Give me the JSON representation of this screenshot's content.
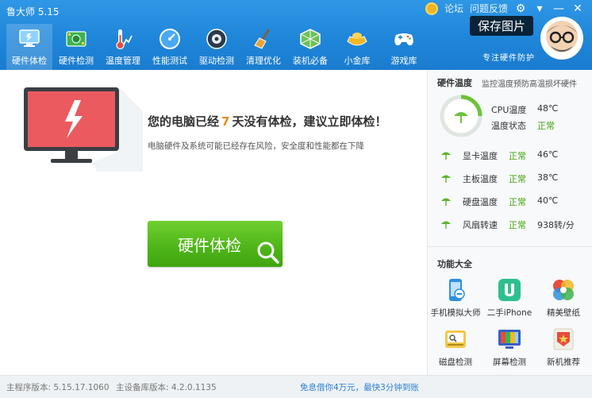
{
  "app": {
    "title": "鲁大师 5.15"
  },
  "window_controls": {
    "forum": "论坛",
    "feedback": "问题反馈",
    "settings": "⚙",
    "menu": "▾",
    "minimize": "—",
    "close": "✕"
  },
  "nav": {
    "tabs": [
      {
        "label": "硬件体检",
        "icon": "monitor-icon",
        "active": true
      },
      {
        "label": "硬件检测",
        "icon": "chip-icon"
      },
      {
        "label": "温度管理",
        "icon": "thermometer-icon"
      },
      {
        "label": "性能测试",
        "icon": "speedometer-icon"
      },
      {
        "label": "驱动检测",
        "icon": "driver-icon"
      },
      {
        "label": "清理优化",
        "icon": "broom-icon"
      },
      {
        "label": "装机必备",
        "icon": "cube-icon"
      },
      {
        "label": "小金库",
        "icon": "gold-ingot-icon"
      },
      {
        "label": "游戏库",
        "icon": "gamepad-icon"
      }
    ]
  },
  "brand": {
    "save_image": "保存图片",
    "name": "鲁大师",
    "slogan": "专注硬件防护"
  },
  "main": {
    "headline_pre": "您的电脑已经",
    "days": "7",
    "headline_post": "天没有体检，建议立即体检！",
    "subtext": "电脑硬件及系统可能已经存在风险，安全度和性能都在下降",
    "check_button": "硬件体检"
  },
  "temps": {
    "header": "硬件温度",
    "header_desc": "监控温度预防高温损坏硬件",
    "cpu_label": "CPU温度",
    "cpu_value": "48℃",
    "state_label": "温度状态",
    "state_value": "正常",
    "sensors": [
      {
        "label": "显卡温度",
        "status": "正常",
        "value": "46℃"
      },
      {
        "label": "主板温度",
        "status": "正常",
        "value": "38℃"
      },
      {
        "label": "硬盘温度",
        "status": "正常",
        "value": "40℃"
      },
      {
        "label": "风扇转速",
        "status": "正常",
        "value": "938转/分"
      }
    ]
  },
  "features": {
    "header": "功能大全",
    "items": [
      {
        "label": "手机模拟大师",
        "icon": "phone-emulator-icon"
      },
      {
        "label": "二手iPhone",
        "icon": "used-iphone-icon"
      },
      {
        "label": "精美壁纸",
        "icon": "wallpaper-icon"
      },
      {
        "label": "磁盘检测",
        "icon": "disk-check-icon"
      },
      {
        "label": "屏幕检测",
        "icon": "screen-check-icon"
      },
      {
        "label": "新机推荐",
        "icon": "new-device-icon"
      }
    ]
  },
  "footer": {
    "main_version": "主程序版本: 5.15.17.1060",
    "db_version": "主设备库版本: 4.2.0.1135",
    "promo": "免息借你4万元，最快3分钟到账"
  },
  "colors": {
    "header_blue": "#1f86d9",
    "accent_orange": "#f08a1d",
    "ok_green": "#45a30e",
    "button_green": "#4db418",
    "promo_blue": "#2b7fd3"
  }
}
